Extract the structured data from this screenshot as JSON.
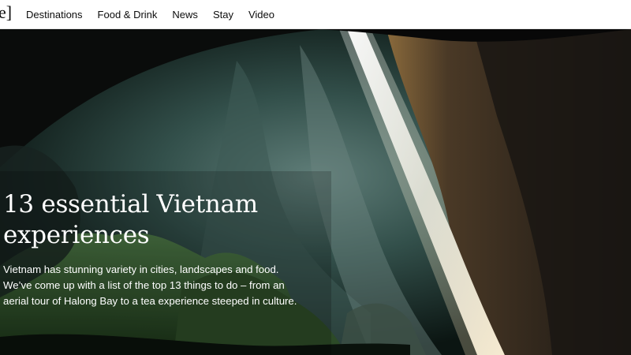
{
  "header": {
    "logo_fragment": "e]",
    "nav": [
      {
        "label": "Destinations"
      },
      {
        "label": "Food & Drink"
      },
      {
        "label": "News"
      },
      {
        "label": "Stay"
      },
      {
        "label": "Video"
      }
    ]
  },
  "hero": {
    "title": "13 essential Vietnam experiences",
    "description": "Vietnam has stunning variety in cities, landscapes and food. We’ve come up with a list of the top 13 things to do – from an aerial tour of Halong Bay to a tea experience steeped in culture."
  }
}
